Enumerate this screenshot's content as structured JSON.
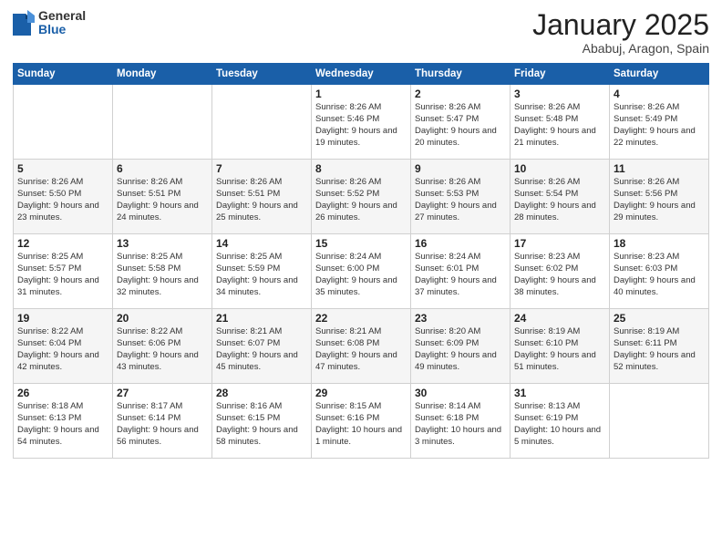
{
  "logo": {
    "general": "General",
    "blue": "Blue"
  },
  "header": {
    "month": "January 2025",
    "location": "Ababuj, Aragon, Spain"
  },
  "weekdays": [
    "Sunday",
    "Monday",
    "Tuesday",
    "Wednesday",
    "Thursday",
    "Friday",
    "Saturday"
  ],
  "weeks": [
    [
      null,
      null,
      null,
      {
        "day": 1,
        "sunrise": "8:26 AM",
        "sunset": "5:46 PM",
        "daylight": "9 hours and 19 minutes."
      },
      {
        "day": 2,
        "sunrise": "8:26 AM",
        "sunset": "5:47 PM",
        "daylight": "9 hours and 20 minutes."
      },
      {
        "day": 3,
        "sunrise": "8:26 AM",
        "sunset": "5:48 PM",
        "daylight": "9 hours and 21 minutes."
      },
      {
        "day": 4,
        "sunrise": "8:26 AM",
        "sunset": "5:49 PM",
        "daylight": "9 hours and 22 minutes."
      }
    ],
    [
      {
        "day": 5,
        "sunrise": "8:26 AM",
        "sunset": "5:50 PM",
        "daylight": "9 hours and 23 minutes."
      },
      {
        "day": 6,
        "sunrise": "8:26 AM",
        "sunset": "5:51 PM",
        "daylight": "9 hours and 24 minutes."
      },
      {
        "day": 7,
        "sunrise": "8:26 AM",
        "sunset": "5:51 PM",
        "daylight": "9 hours and 25 minutes."
      },
      {
        "day": 8,
        "sunrise": "8:26 AM",
        "sunset": "5:52 PM",
        "daylight": "9 hours and 26 minutes."
      },
      {
        "day": 9,
        "sunrise": "8:26 AM",
        "sunset": "5:53 PM",
        "daylight": "9 hours and 27 minutes."
      },
      {
        "day": 10,
        "sunrise": "8:26 AM",
        "sunset": "5:54 PM",
        "daylight": "9 hours and 28 minutes."
      },
      {
        "day": 11,
        "sunrise": "8:26 AM",
        "sunset": "5:56 PM",
        "daylight": "9 hours and 29 minutes."
      }
    ],
    [
      {
        "day": 12,
        "sunrise": "8:25 AM",
        "sunset": "5:57 PM",
        "daylight": "9 hours and 31 minutes."
      },
      {
        "day": 13,
        "sunrise": "8:25 AM",
        "sunset": "5:58 PM",
        "daylight": "9 hours and 32 minutes."
      },
      {
        "day": 14,
        "sunrise": "8:25 AM",
        "sunset": "5:59 PM",
        "daylight": "9 hours and 34 minutes."
      },
      {
        "day": 15,
        "sunrise": "8:24 AM",
        "sunset": "6:00 PM",
        "daylight": "9 hours and 35 minutes."
      },
      {
        "day": 16,
        "sunrise": "8:24 AM",
        "sunset": "6:01 PM",
        "daylight": "9 hours and 37 minutes."
      },
      {
        "day": 17,
        "sunrise": "8:23 AM",
        "sunset": "6:02 PM",
        "daylight": "9 hours and 38 minutes."
      },
      {
        "day": 18,
        "sunrise": "8:23 AM",
        "sunset": "6:03 PM",
        "daylight": "9 hours and 40 minutes."
      }
    ],
    [
      {
        "day": 19,
        "sunrise": "8:22 AM",
        "sunset": "6:04 PM",
        "daylight": "9 hours and 42 minutes."
      },
      {
        "day": 20,
        "sunrise": "8:22 AM",
        "sunset": "6:06 PM",
        "daylight": "9 hours and 43 minutes."
      },
      {
        "day": 21,
        "sunrise": "8:21 AM",
        "sunset": "6:07 PM",
        "daylight": "9 hours and 45 minutes."
      },
      {
        "day": 22,
        "sunrise": "8:21 AM",
        "sunset": "6:08 PM",
        "daylight": "9 hours and 47 minutes."
      },
      {
        "day": 23,
        "sunrise": "8:20 AM",
        "sunset": "6:09 PM",
        "daylight": "9 hours and 49 minutes."
      },
      {
        "day": 24,
        "sunrise": "8:19 AM",
        "sunset": "6:10 PM",
        "daylight": "9 hours and 51 minutes."
      },
      {
        "day": 25,
        "sunrise": "8:19 AM",
        "sunset": "6:11 PM",
        "daylight": "9 hours and 52 minutes."
      }
    ],
    [
      {
        "day": 26,
        "sunrise": "8:18 AM",
        "sunset": "6:13 PM",
        "daylight": "9 hours and 54 minutes."
      },
      {
        "day": 27,
        "sunrise": "8:17 AM",
        "sunset": "6:14 PM",
        "daylight": "9 hours and 56 minutes."
      },
      {
        "day": 28,
        "sunrise": "8:16 AM",
        "sunset": "6:15 PM",
        "daylight": "9 hours and 58 minutes."
      },
      {
        "day": 29,
        "sunrise": "8:15 AM",
        "sunset": "6:16 PM",
        "daylight": "10 hours and 1 minute."
      },
      {
        "day": 30,
        "sunrise": "8:14 AM",
        "sunset": "6:18 PM",
        "daylight": "10 hours and 3 minutes."
      },
      {
        "day": 31,
        "sunrise": "8:13 AM",
        "sunset": "6:19 PM",
        "daylight": "10 hours and 5 minutes."
      },
      null
    ]
  ]
}
